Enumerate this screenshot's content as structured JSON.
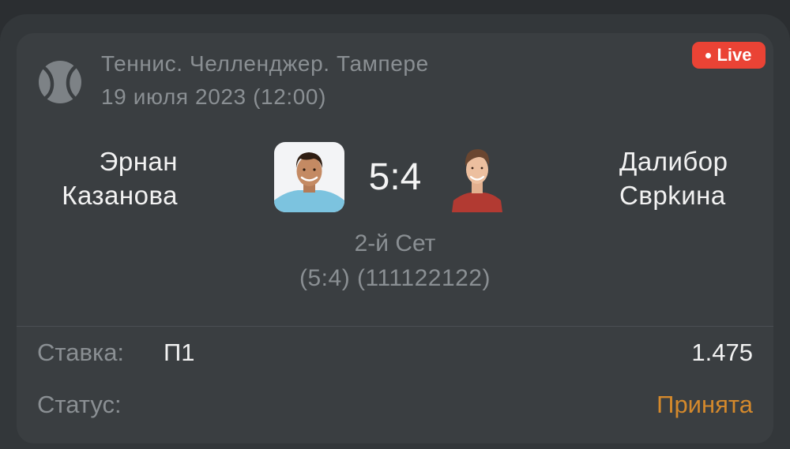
{
  "event": {
    "sport_icon": "tennis-ball-icon",
    "tournament": "Теннис. Челленджер. Тампере",
    "datetime": "19 июля 2023 (12:00)",
    "live_label": "Live"
  },
  "match": {
    "player1": {
      "first": "Эрнан",
      "last": "Казанова",
      "avatar": "player1-avatar"
    },
    "player2": {
      "first": "Далибор",
      "last": "Сврkина",
      "avatar": "player2-avatar"
    },
    "score": "5:4",
    "set_label": "2-й Сет",
    "set_detail": "(5:4) (111122122)"
  },
  "bet": {
    "label": "Ставка:",
    "value": "П1",
    "odds": "1.475",
    "status_label": "Статус:",
    "status_value": "Принята"
  },
  "colors": {
    "live": "#ea4335",
    "status_accepted": "#d4892c",
    "card_bg": "#3a3e41"
  }
}
